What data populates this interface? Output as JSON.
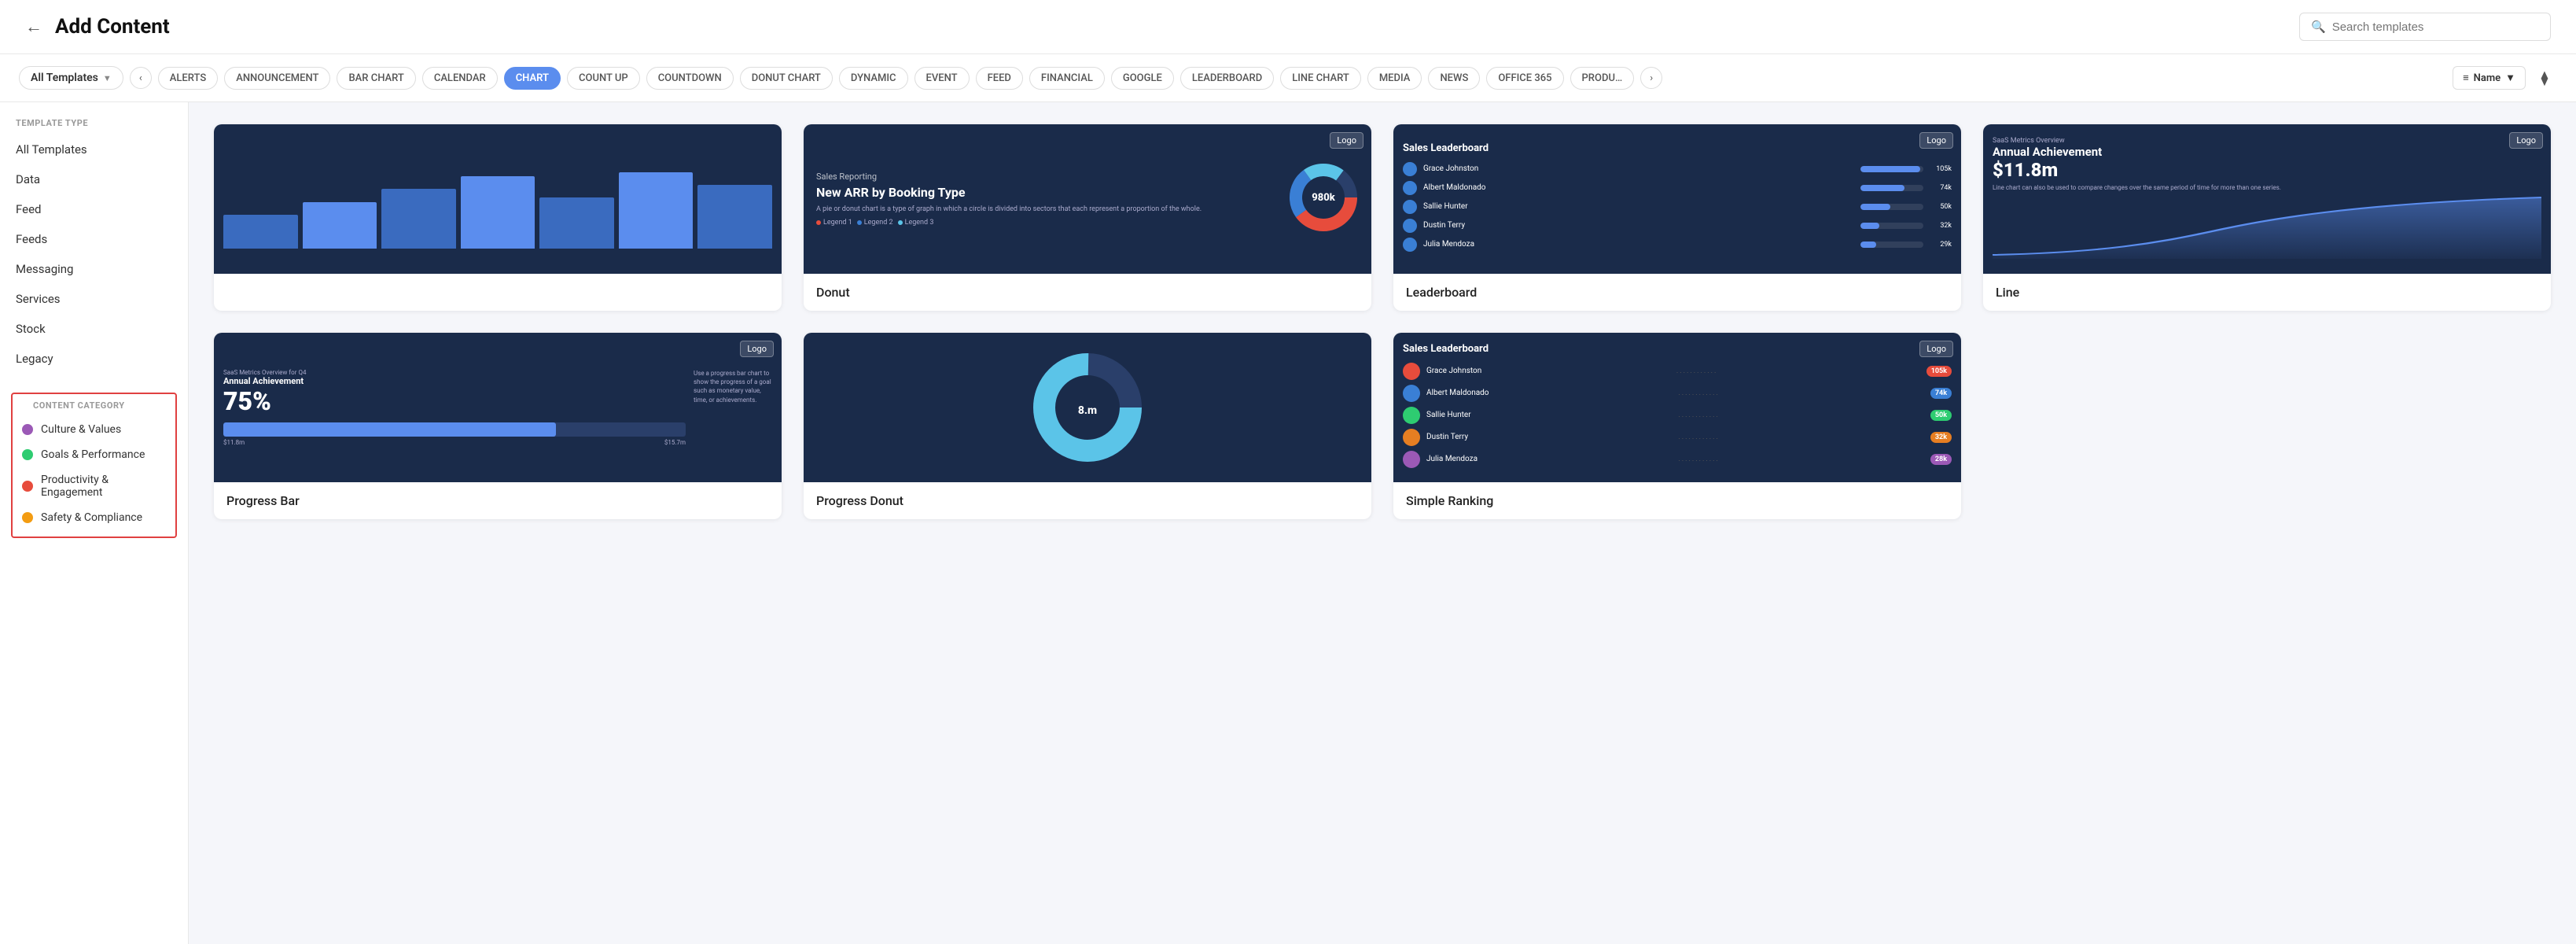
{
  "header": {
    "back_icon": "←",
    "title": "Add Content",
    "search_placeholder": "Search templates"
  },
  "filter_bar": {
    "all_templates_label": "All Templates",
    "nav_prev": "‹",
    "nav_next": "›",
    "chips": [
      {
        "label": "ALERTS",
        "active": false
      },
      {
        "label": "ANNOUNCEMENT",
        "active": false
      },
      {
        "label": "BAR CHART",
        "active": false
      },
      {
        "label": "CALENDAR",
        "active": false
      },
      {
        "label": "CHART",
        "active": true
      },
      {
        "label": "COUNT UP",
        "active": false
      },
      {
        "label": "COUNTDOWN",
        "active": false
      },
      {
        "label": "DONUT CHART",
        "active": false
      },
      {
        "label": "DYNAMIC",
        "active": false
      },
      {
        "label": "EVENT",
        "active": false
      },
      {
        "label": "FEED",
        "active": false
      },
      {
        "label": "FINANCIAL",
        "active": false
      },
      {
        "label": "GOOGLE",
        "active": false
      },
      {
        "label": "LEADERBOARD",
        "active": false
      },
      {
        "label": "LINE CHART",
        "active": false
      },
      {
        "label": "MEDIA",
        "active": false
      },
      {
        "label": "NEWS",
        "active": false
      },
      {
        "label": "OFFICE 365",
        "active": false
      },
      {
        "label": "PRODU…",
        "active": false
      }
    ],
    "sort_label": "Name",
    "sort_icon": "≡",
    "filter_icon": "⧫"
  },
  "sidebar": {
    "template_type_label": "TEMPLATE TYPE",
    "template_types": [
      {
        "label": "All Templates"
      },
      {
        "label": "Data"
      },
      {
        "label": "Feed"
      },
      {
        "label": "Feeds"
      },
      {
        "label": "Messaging"
      },
      {
        "label": "Services"
      },
      {
        "label": "Stock"
      },
      {
        "label": "Legacy"
      }
    ],
    "content_category_label": "CONTENT CATEGORY",
    "categories": [
      {
        "label": "Culture & Values",
        "color": "#9b59b6"
      },
      {
        "label": "Goals & Performance",
        "color": "#2ecc71"
      },
      {
        "label": "Productivity & Engagement",
        "color": "#e74c3c"
      },
      {
        "label": "Safety & Compliance",
        "color": "#f39c12"
      }
    ]
  },
  "grid": {
    "cards": [
      {
        "id": "bar-chart-partial",
        "label": "",
        "show_logo": false,
        "type": "bar-partial"
      },
      {
        "id": "donut",
        "label": "Donut",
        "show_logo": true,
        "type": "donut",
        "preview": {
          "subtitle": "Sales Reporting",
          "title": "New ARR by Booking Type",
          "description": "A pie or donut chart is a type of graph in which a circle is divided into sectors that each represent a proportion of the whole.",
          "value": "980k",
          "legend": [
            "Legend 1",
            "Legend 2",
            "Legend 3"
          ]
        }
      },
      {
        "id": "leaderboard",
        "label": "Leaderboard",
        "show_logo": true,
        "type": "leaderboard",
        "preview": {
          "title": "Sales Leaderboard",
          "rows": [
            {
              "name": "Grace Johnston",
              "bar": 95,
              "val": "105k"
            },
            {
              "name": "Albert Maldonado",
              "bar": 70,
              "val": "74k"
            },
            {
              "name": "Sallie Hunter",
              "bar": 48,
              "val": "50k"
            },
            {
              "name": "Dustin Terry",
              "bar": 30,
              "val": "32k"
            },
            {
              "name": "Julia Mendoza",
              "bar": 25,
              "val": "29k"
            }
          ]
        }
      },
      {
        "id": "line",
        "label": "Line",
        "show_logo": true,
        "type": "line",
        "preview": {
          "subtitle": "SaaS Metrics Overview",
          "title": "Annual Achievement",
          "metric": "$11.8m",
          "desc": "Line chart can also be used to compare changes over the same period of time for more than one series."
        }
      },
      {
        "id": "progress-bar",
        "label": "Progress Bar",
        "show_logo": true,
        "type": "progress-bar",
        "preview": {
          "header": "SaaS Metrics Overview for Q4",
          "title": "Annual Achievement",
          "percent": "75%",
          "bar_pct": 72,
          "marker1": "$11.8m",
          "marker2": "$15.7m",
          "side_text": "Use a progress bar chart to show the progress of a goal such as monetary value, time, or achievements."
        }
      },
      {
        "id": "progress-donut-partial",
        "label": "Progress Donut",
        "show_logo": false,
        "type": "progress-donut-partial"
      },
      {
        "id": "simple-ranking",
        "label": "Simple Ranking",
        "show_logo": true,
        "type": "simple-ranking",
        "preview": {
          "title": "Sales Leaderboard",
          "rows": [
            {
              "name": "Grace Johnston",
              "val": "105k",
              "color": "#e74c3c"
            },
            {
              "name": "Albert Maldonado",
              "val": "74k",
              "color": "#3a7fd5"
            },
            {
              "name": "Sallie Hunter",
              "val": "50k",
              "color": "#2ecc71"
            },
            {
              "name": "Dustin Terry",
              "val": "32k",
              "color": "#e67e22"
            },
            {
              "name": "Julia Mendoza",
              "val": "28k",
              "color": "#9b59b6"
            }
          ]
        }
      }
    ]
  }
}
